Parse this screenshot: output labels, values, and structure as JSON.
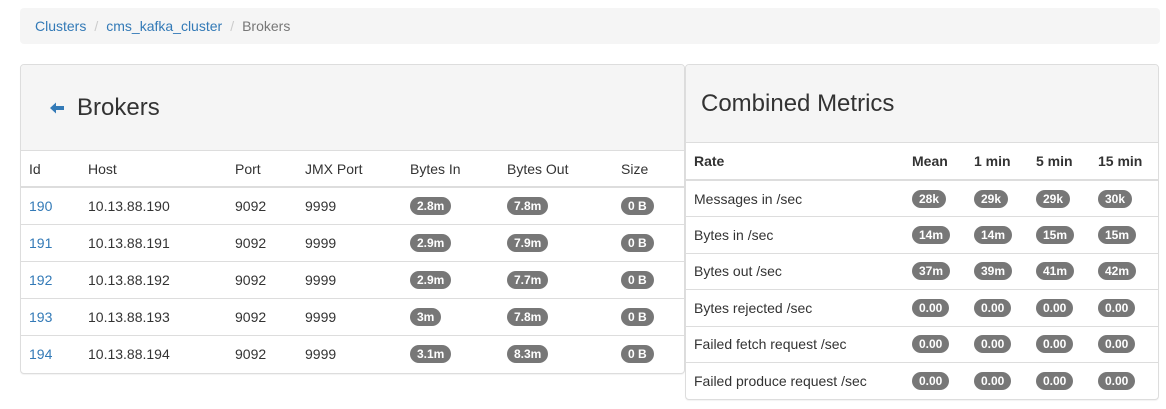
{
  "breadcrumb": {
    "items": [
      {
        "label": "Clusters"
      },
      {
        "label": "cms_kafka_cluster"
      },
      {
        "label": "Brokers"
      }
    ],
    "separator": "/"
  },
  "brokers": {
    "title": "Brokers",
    "back_icon": "arrow-left-icon",
    "columns": [
      "Id",
      "Host",
      "Port",
      "JMX Port",
      "Bytes In",
      "Bytes Out",
      "Size"
    ],
    "rows": [
      {
        "id": "190",
        "host": "10.13.88.190",
        "port": "9092",
        "jmx_port": "9999",
        "bytes_in": "2.8m",
        "bytes_out": "7.8m",
        "size": "0 B"
      },
      {
        "id": "191",
        "host": "10.13.88.191",
        "port": "9092",
        "jmx_port": "9999",
        "bytes_in": "2.9m",
        "bytes_out": "7.9m",
        "size": "0 B"
      },
      {
        "id": "192",
        "host": "10.13.88.192",
        "port": "9092",
        "jmx_port": "9999",
        "bytes_in": "2.9m",
        "bytes_out": "7.7m",
        "size": "0 B"
      },
      {
        "id": "193",
        "host": "10.13.88.193",
        "port": "9092",
        "jmx_port": "9999",
        "bytes_in": "3m",
        "bytes_out": "7.8m",
        "size": "0 B"
      },
      {
        "id": "194",
        "host": "10.13.88.194",
        "port": "9092",
        "jmx_port": "9999",
        "bytes_in": "3.1m",
        "bytes_out": "8.3m",
        "size": "0 B"
      }
    ]
  },
  "metrics": {
    "title": "Combined Metrics",
    "columns": [
      "Rate",
      "Mean",
      "1 min",
      "5 min",
      "15 min"
    ],
    "rows": [
      {
        "rate": "Messages in /sec",
        "mean": "28k",
        "m1": "29k",
        "m5": "29k",
        "m15": "30k"
      },
      {
        "rate": "Bytes in /sec",
        "mean": "14m",
        "m1": "14m",
        "m5": "15m",
        "m15": "15m"
      },
      {
        "rate": "Bytes out /sec",
        "mean": "37m",
        "m1": "39m",
        "m5": "41m",
        "m15": "42m"
      },
      {
        "rate": "Bytes rejected /sec",
        "mean": "0.00",
        "m1": "0.00",
        "m5": "0.00",
        "m15": "0.00"
      },
      {
        "rate": "Failed fetch request /sec",
        "mean": "0.00",
        "m1": "0.00",
        "m5": "0.00",
        "m15": "0.00"
      },
      {
        "rate": "Failed produce request /sec",
        "mean": "0.00",
        "m1": "0.00",
        "m5": "0.00",
        "m15": "0.00"
      }
    ]
  },
  "colors": {
    "link": "#337ab7",
    "badge": "#777777",
    "panel_heading": "#f5f5f5",
    "border": "#dddddd"
  }
}
